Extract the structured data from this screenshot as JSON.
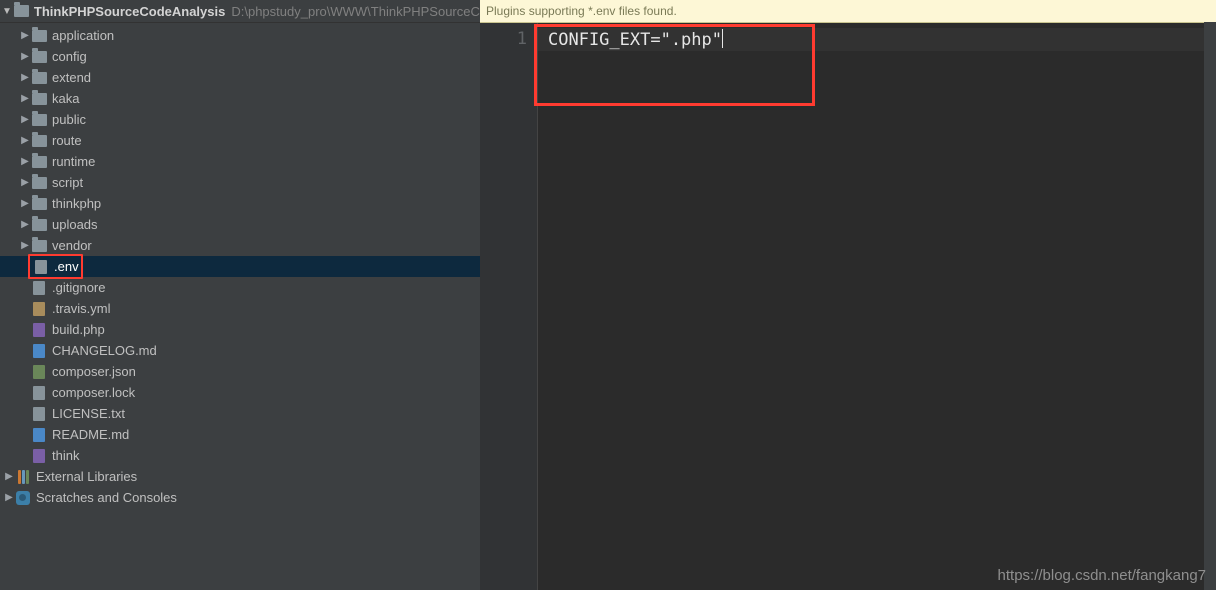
{
  "breadcrumb": {
    "project_name": "ThinkPHPSourceCodeAnalysis",
    "project_path": "D:\\phpstudy_pro\\WWW\\ThinkPHPSourceCo"
  },
  "tree": {
    "folders": [
      {
        "label": "application"
      },
      {
        "label": "config"
      },
      {
        "label": "extend"
      },
      {
        "label": "kaka"
      },
      {
        "label": "public"
      },
      {
        "label": "route"
      },
      {
        "label": "runtime"
      },
      {
        "label": "script"
      },
      {
        "label": "thinkphp"
      },
      {
        "label": "uploads"
      },
      {
        "label": "vendor"
      }
    ],
    "files": [
      {
        "label": ".env",
        "kind": "file",
        "selected": true,
        "boxed": true
      },
      {
        "label": ".gitignore",
        "kind": "file"
      },
      {
        "label": ".travis.yml",
        "kind": "yml"
      },
      {
        "label": "build.php",
        "kind": "php"
      },
      {
        "label": "CHANGELOG.md",
        "kind": "md"
      },
      {
        "label": "composer.json",
        "kind": "json"
      },
      {
        "label": "composer.lock",
        "kind": "file"
      },
      {
        "label": "LICENSE.txt",
        "kind": "file"
      },
      {
        "label": "README.md",
        "kind": "md"
      },
      {
        "label": "think",
        "kind": "php"
      }
    ],
    "external_libraries": "External Libraries",
    "scratches": "Scratches and Consoles"
  },
  "editor": {
    "notice": "Plugins supporting *.env files found.",
    "line_number": "1",
    "code_line": "CONFIG_EXT=\".php\""
  },
  "watermark": "https://blog.csdn.net/fangkang7"
}
